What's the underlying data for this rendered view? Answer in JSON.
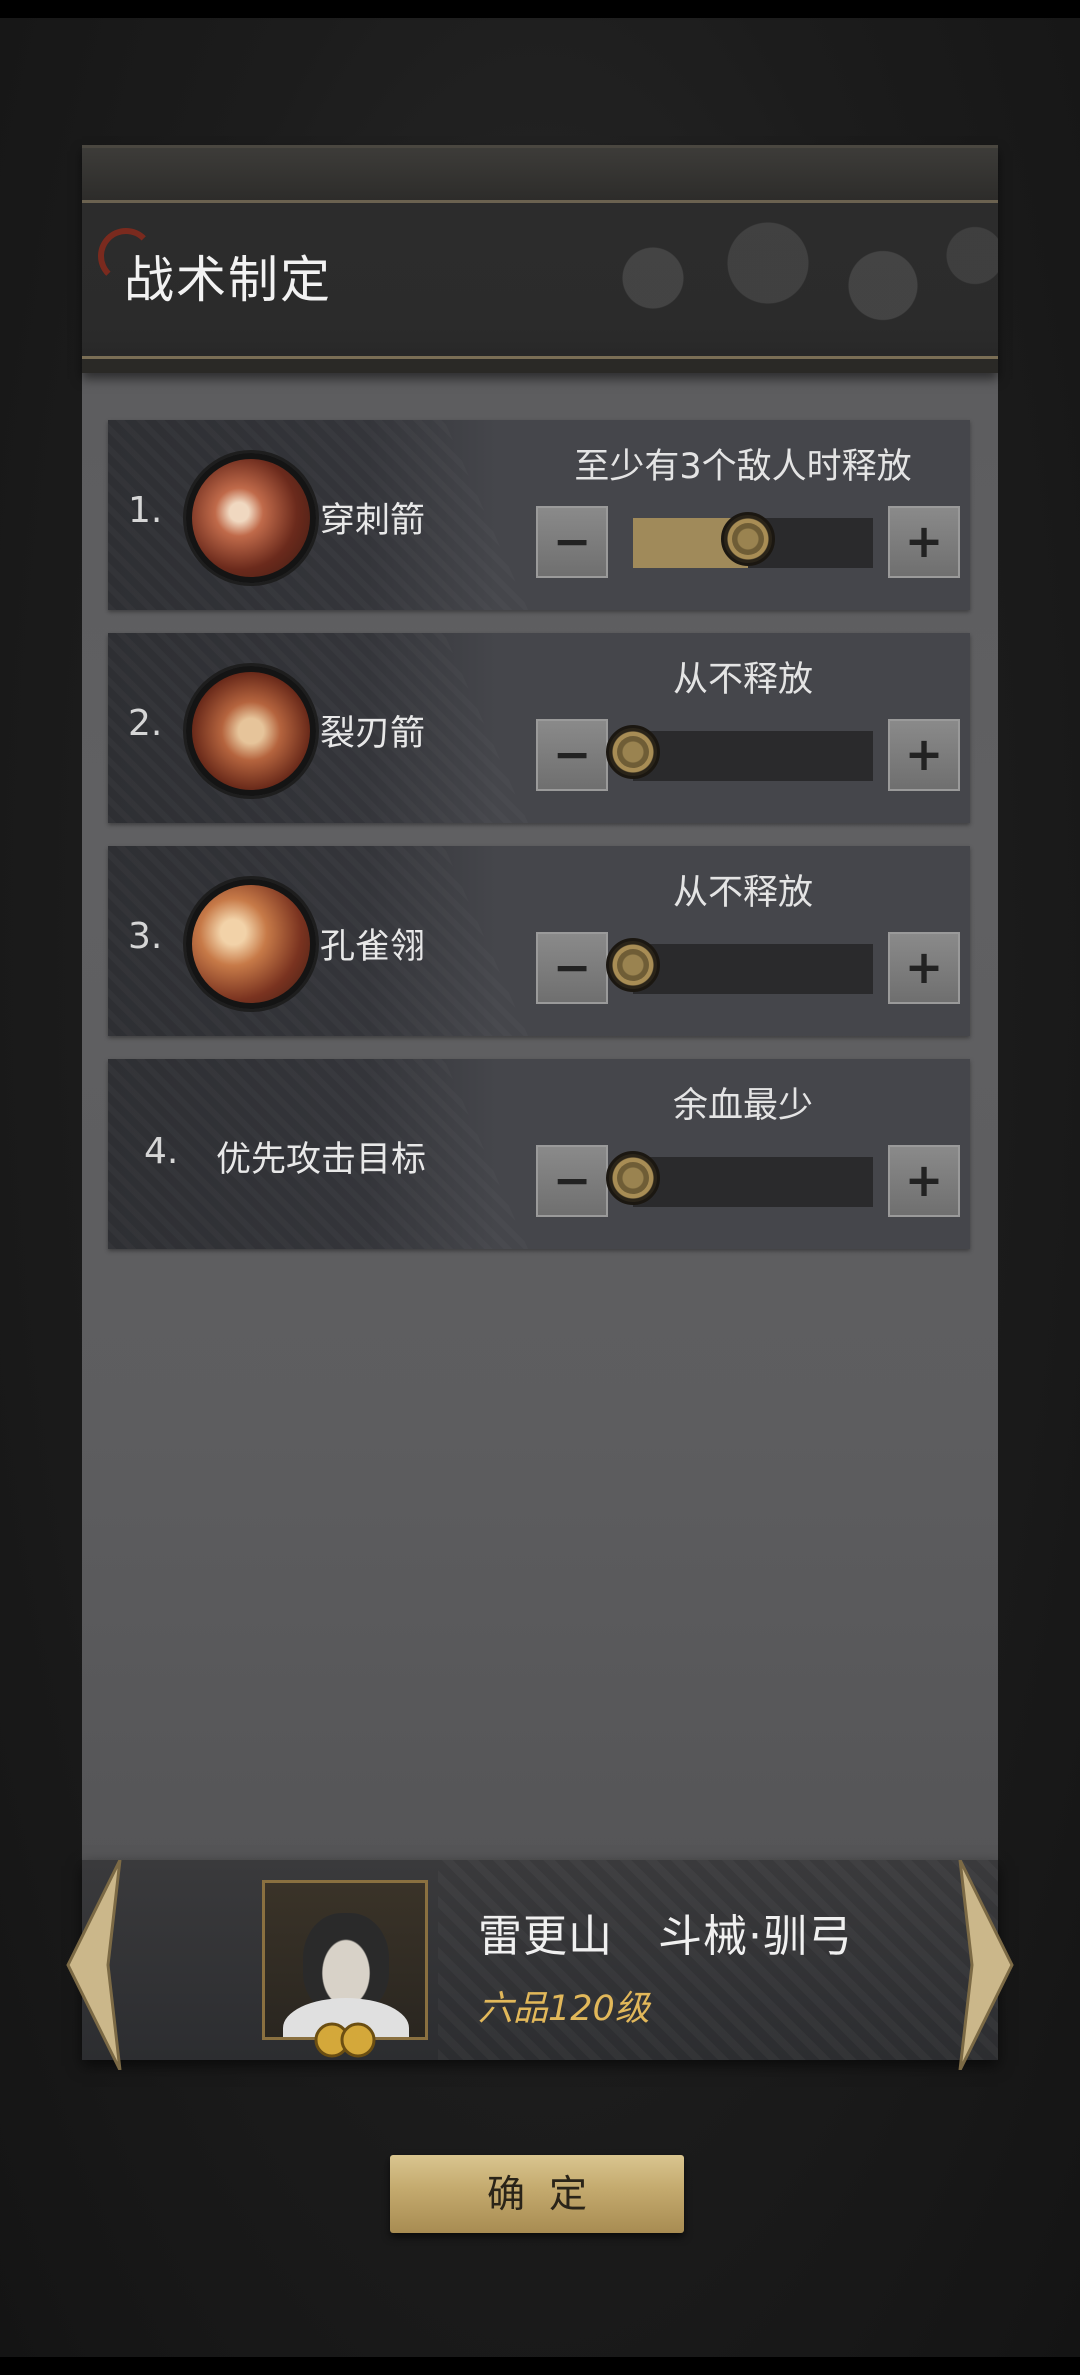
{
  "window": {
    "title": "战术制定"
  },
  "tactics": [
    {
      "index": "1.",
      "skill_name": "穿刺箭",
      "icon": "piercing-arrow-icon",
      "condition": "至少有3个敌人时释放",
      "level": 0.48
    },
    {
      "index": "2.",
      "skill_name": "裂刃箭",
      "icon": "split-blade-arrow-icon",
      "condition": "从不释放",
      "level": 0
    },
    {
      "index": "3.",
      "skill_name": "孔雀翎",
      "icon": "peacock-feather-icon",
      "condition": "从不释放",
      "level": 0
    },
    {
      "index": "4.",
      "skill_name": "优先攻击目标",
      "icon": "",
      "condition": "余血最少",
      "level": 0
    }
  ],
  "controls": {
    "minus_label": "−",
    "plus_label": "+"
  },
  "hero": {
    "name": "雷更山　斗械·驯弓",
    "rank": "六品120级"
  },
  "footer": {
    "confirm_label": "确定"
  },
  "colors": {
    "accent_gold": "#a08a5a",
    "rank_text": "#e2b85a",
    "panel": "#5e5e60"
  }
}
